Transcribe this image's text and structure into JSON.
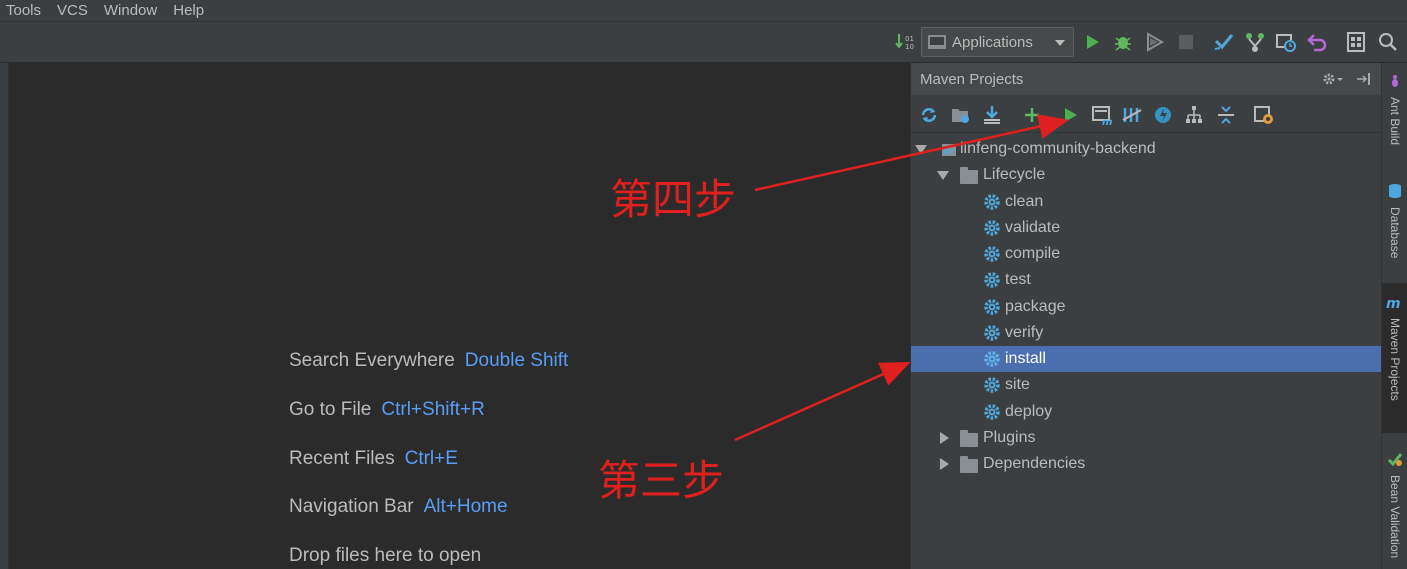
{
  "menu": [
    "Tools",
    "VCS",
    "Window",
    "Help"
  ],
  "toolbar": {
    "run_config": "Applications"
  },
  "editor": {
    "hints": [
      {
        "label": "Search Everywhere",
        "key": "Double Shift"
      },
      {
        "label": "Go to File",
        "key": "Ctrl+Shift+R"
      },
      {
        "label": "Recent Files",
        "key": "Ctrl+E"
      },
      {
        "label": "Navigation Bar",
        "key": "Alt+Home"
      },
      {
        "label": "Drop files here to open",
        "key": ""
      }
    ]
  },
  "maven": {
    "title": "Maven Projects",
    "project": "linfeng-community-backend",
    "lifecycle_label": "Lifecycle",
    "phases": [
      "clean",
      "validate",
      "compile",
      "test",
      "package",
      "verify",
      "install",
      "site",
      "deploy"
    ],
    "selected_phase": "install",
    "plugins_label": "Plugins",
    "dependencies_label": "Dependencies"
  },
  "sidebar_right": [
    "Ant Build",
    "Database",
    "Maven Projects",
    "Bean Validation"
  ],
  "annotations": {
    "step4": "第四步",
    "step3": "第三步"
  },
  "colors": {
    "accent": "#589df6",
    "selection": "#4b6eaf",
    "annotation": "#e0201e",
    "run_green": "#4caf50"
  }
}
